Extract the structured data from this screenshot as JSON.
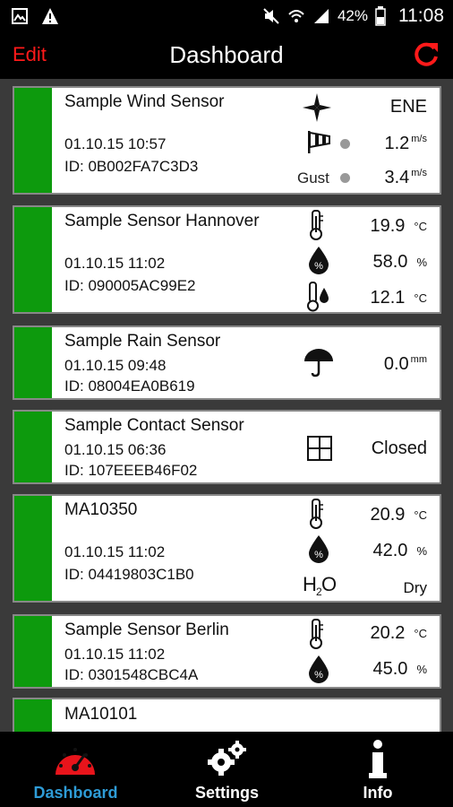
{
  "status_bar": {
    "battery": "42%",
    "time": "11:08"
  },
  "app_bar": {
    "edit_label": "Edit",
    "title": "Dashboard",
    "refresh_icon": "refresh-icon"
  },
  "cards": [
    {
      "name": "Sample Wind Sensor",
      "date": "01.10.15  10:57",
      "id": "ID: 0B002FA7C3D3",
      "readings": {
        "direction": "ENE",
        "speed": "1.2",
        "speed_unit": "m/s",
        "gust_label": "Gust",
        "gust": "3.4",
        "gust_unit": "m/s"
      }
    },
    {
      "name": "Sample Sensor Hannover",
      "date": "01.10.15  11:02",
      "id": "ID: 090005AC99E2",
      "readings": {
        "temp": "19.9",
        "temp_unit": "°C",
        "humidity": "58.0",
        "humidity_unit": "%",
        "dewpoint": "12.1",
        "dewpoint_unit": "°C"
      }
    },
    {
      "name": "Sample Rain Sensor",
      "date": "01.10.15  09:48",
      "id": "ID: 08004EA0B619",
      "readings": {
        "rain": "0.0",
        "rain_unit": "mm"
      }
    },
    {
      "name": "Sample Contact Sensor",
      "date": "01.10.15  06:36",
      "id": "ID: 107EEEB46F02",
      "readings": {
        "state": "Closed"
      }
    },
    {
      "name": "MA10350",
      "date": "01.10.15  11:02",
      "id": "ID: 04419803C1B0",
      "readings": {
        "temp": "20.9",
        "temp_unit": "°C",
        "humidity": "42.0",
        "humidity_unit": "%",
        "water_label": "H2O",
        "water_state": "Dry"
      }
    },
    {
      "name": "Sample Sensor Berlin",
      "date": "01.10.15  11:02",
      "id": "ID: 0301548CBC4A",
      "readings": {
        "temp": "20.2",
        "temp_unit": "°C",
        "humidity": "45.0",
        "humidity_unit": "%"
      }
    },
    {
      "name": "MA10101"
    }
  ],
  "bottom_nav": [
    {
      "label": "Dashboard",
      "color": "#2e9bd6"
    },
    {
      "label": "Settings",
      "color": "#ffffff"
    },
    {
      "label": "Info",
      "color": "#ffffff"
    }
  ],
  "colors": {
    "accent_red": "#ff1a1a",
    "status_green": "#0d9a0d",
    "tab_active": "#2e9bd6"
  }
}
